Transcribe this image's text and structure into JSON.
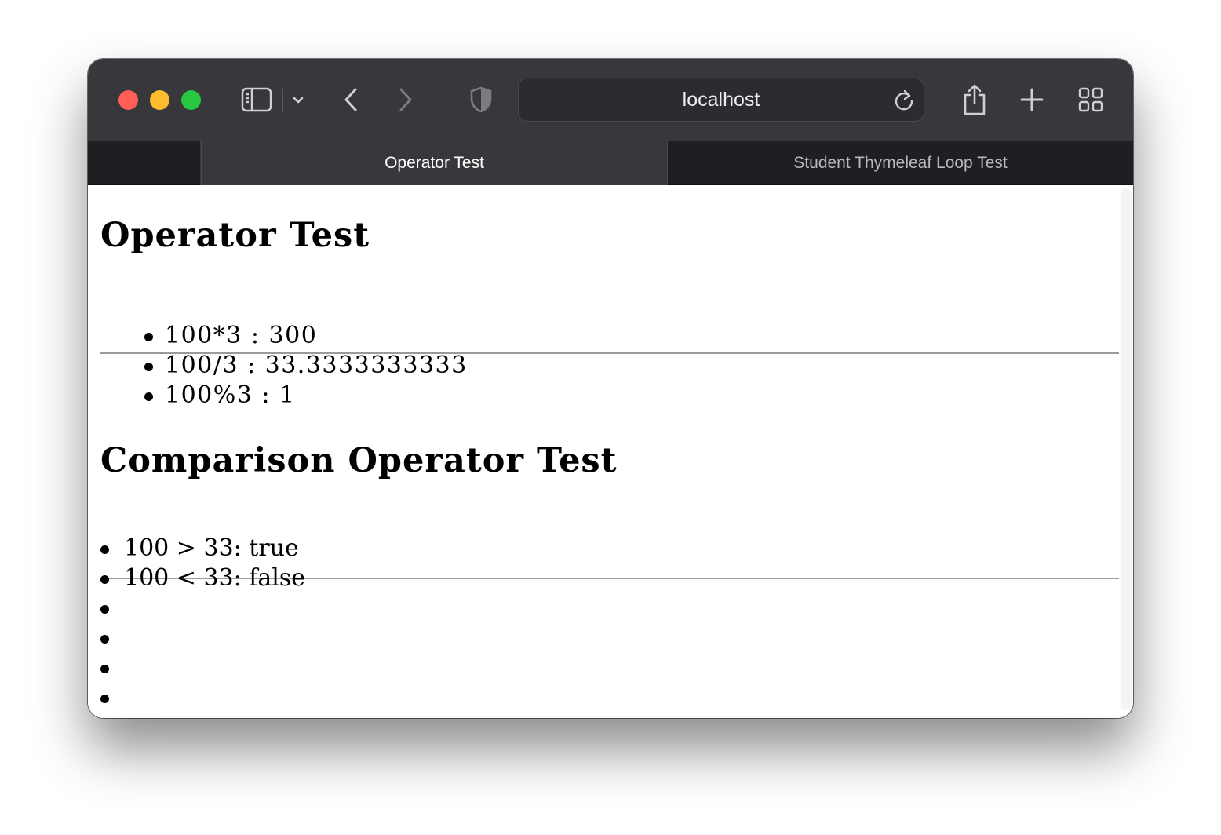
{
  "browser": {
    "url": "localhost",
    "tabs": [
      {
        "label": "Operator Test",
        "active": true
      },
      {
        "label": "Student Thymeleaf Loop Test",
        "active": false
      }
    ],
    "icons": {
      "sidebar": "sidebar-icon",
      "chevron": "chevron-down-icon",
      "back": "back-arrow-icon",
      "forward": "forward-arrow-icon",
      "privacy": "shield-icon",
      "reload": "reload-icon",
      "share": "share-icon",
      "new_tab": "plus-icon",
      "tab_overview": "grid-icon"
    }
  },
  "page": {
    "heading1": "Operator Test",
    "operators": [
      "100*3 : 300",
      "100/3 : 33.3333333333",
      "100%3 : 1"
    ],
    "heading2": "Comparison Operator Test",
    "comparisons": [
      "100 > 33: true",
      "100 < 33: false",
      "",
      "",
      "",
      ""
    ]
  }
}
